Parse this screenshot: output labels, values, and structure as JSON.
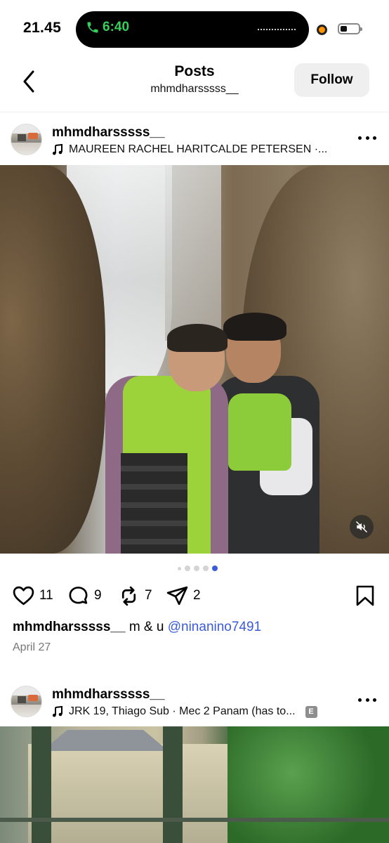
{
  "status_bar": {
    "time": "21.45",
    "call_duration": "6:40",
    "call_color": "#35d05a"
  },
  "header": {
    "title": "Posts",
    "subtitle": "mhmdharsssss__",
    "follow_label": "Follow"
  },
  "posts": [
    {
      "username": "mhmdharsssss__",
      "music": "MAUREEN RACHEL HARITCALDE PETERSEN ·...",
      "carousel": {
        "count": 5,
        "active_index": 4
      },
      "likes": "11",
      "comments": "9",
      "reposts": "7",
      "shares": "2",
      "caption_user": "mhmdharsssss__",
      "caption_text": "m & u",
      "caption_mention": "@ninanino7491",
      "date": "April 27"
    },
    {
      "username": "mhmdharsssss__",
      "music": "JRK 19, Thiago Sub · Mec 2 Panam (has to...",
      "explicit_badge": "E"
    }
  ],
  "colors": {
    "accent_link": "#3b5bdb",
    "follow_bg": "#efefef",
    "secondary_text": "#777777"
  },
  "icons": {
    "back": "chevron-left-icon",
    "music": "music-note-icon",
    "more": "more-horizontal-icon",
    "mute": "speaker-muted-icon",
    "like": "heart-icon",
    "comment": "comment-bubble-icon",
    "repost": "repost-icon",
    "share": "send-icon",
    "save": "bookmark-icon"
  }
}
